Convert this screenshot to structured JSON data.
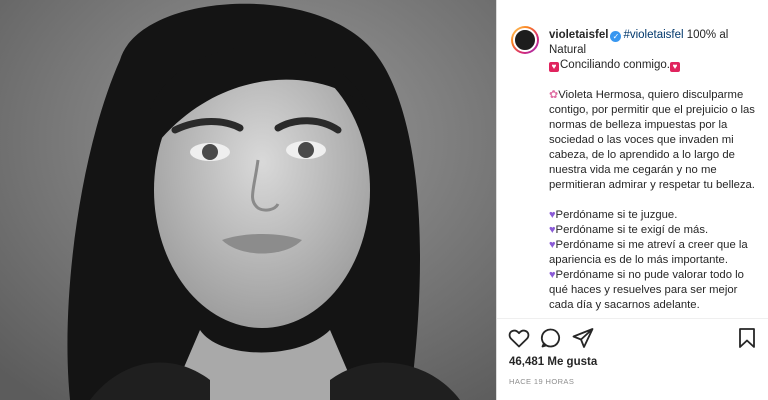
{
  "post": {
    "username": "violetaisfel",
    "caption_hashtag": "#violetaisfel",
    "caption_head": " 100% al Natural",
    "subtitle": "Conciliando conmigo.",
    "paragraph1": "Violeta Hermosa, quiero disculparme contigo, por permitir que el prejuicio o las normas de belleza impuestas por la sociedad o las voces que invaden mi cabeza, de lo aprendido a lo largo de nuestra vida me cegarán y no me permitieran admirar y respetar tu belleza.",
    "lines": [
      "Perdóname si te juzgue.",
      "Perdóname si te exigí de más.",
      "Perdóname si me atreví a creer que la apariencia es de lo más importante.",
      "Perdóname si no pude valorar todo lo qué haces y resuelves para ser mejor cada día y sacarnos adelante."
    ],
    "likes": "46,481 Me gusta",
    "timestamp": "HACE 19 HORAS"
  },
  "icons": {
    "verified": "verified-badge-icon",
    "like": "heart-icon",
    "comment": "comment-icon",
    "share": "share-icon",
    "save": "bookmark-icon"
  },
  "colors": {
    "hashtag": "#00376b",
    "verified": "#3897f0",
    "muted": "#8e8e8e",
    "heart_emoji": "#e0245e",
    "purple_heart": "#8a5bd6"
  }
}
